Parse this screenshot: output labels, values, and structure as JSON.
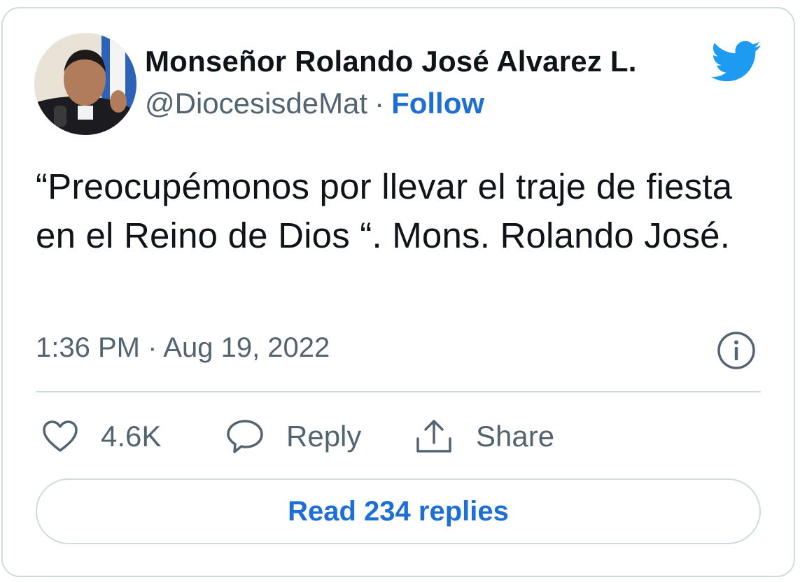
{
  "author": {
    "name": "Monseñor Rolando José Alvarez L.",
    "handle": "@DiocesisdeMat",
    "separator": "·",
    "follow_label": "Follow"
  },
  "tweet": {
    "text": "“Preocupémonos por llevar el traje de fiesta en el Reino de Dios “. Mons. Rolando José.",
    "timestamp": "1:36 PM · Aug 19, 2022"
  },
  "actions": {
    "like_count": "4.6K",
    "reply_label": "Reply",
    "share_label": "Share"
  },
  "footer": {
    "read_replies_label": "Read 234 replies"
  },
  "colors": {
    "link": "#1d6fd3",
    "twitter_blue": "#1d9bf0",
    "muted": "#536471",
    "border": "#cfd9de",
    "text": "#0f1419"
  },
  "icons": {
    "brand": "twitter-bird-icon",
    "info": "info-icon",
    "like": "heart-icon",
    "reply": "speech-bubble-icon",
    "share": "share-upload-icon"
  }
}
